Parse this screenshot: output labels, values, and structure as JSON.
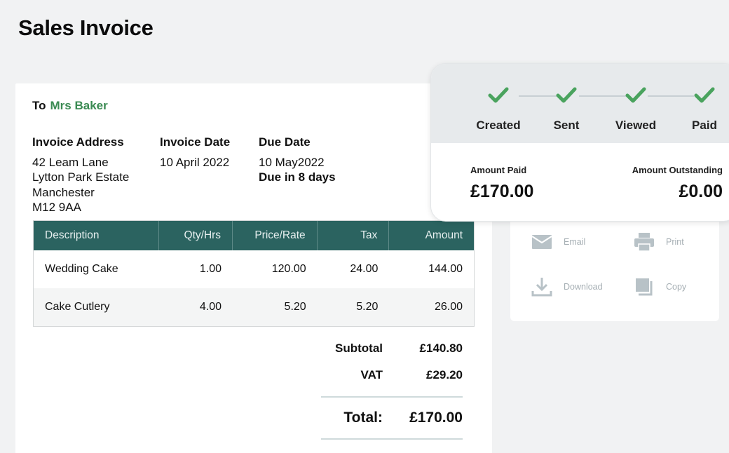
{
  "page": {
    "title": "Sales Invoice"
  },
  "invoice": {
    "to_label": "To",
    "to_name": "Mrs Baker",
    "address": {
      "heading": "Invoice Address",
      "lines": [
        "42 Leam Lane",
        "Lytton Park Estate",
        "Manchester",
        "M12 9AA"
      ]
    },
    "invoice_date": {
      "heading": "Invoice Date",
      "value": "10 April 2022"
    },
    "due_date": {
      "heading": "Due Date",
      "value": "10 May2022",
      "due_in": "Due in 8 days"
    },
    "table": {
      "headers": [
        "Description",
        "Qty/Hrs",
        "Price/Rate",
        "Tax",
        "Amount"
      ],
      "rows": [
        [
          "Wedding Cake",
          "1.00",
          "120.00",
          "24.00",
          "144.00"
        ],
        [
          "Cake Cutlery",
          "4.00",
          "5.20",
          "5.20",
          "26.00"
        ]
      ]
    },
    "totals": {
      "subtotal_label": "Subtotal",
      "subtotal_value": "£140.80",
      "vat_label": "VAT",
      "vat_value": "£29.20",
      "total_label": "Total:",
      "total_value": "£170.00"
    }
  },
  "actions": {
    "email": "Email",
    "print": "Print",
    "download": "Download",
    "copy": "Copy"
  },
  "status": {
    "steps": [
      "Created",
      "Sent",
      "Viewed",
      "Paid"
    ],
    "amount_paid_label": "Amount Paid",
    "amount_paid_value": "£170.00",
    "amount_outstanding_label": "Amount Outstanding",
    "amount_outstanding_value": "£0.00"
  },
  "colors": {
    "accent_green": "#3a8a52",
    "table_header": "#2b6360",
    "check_green": "#4aa35e"
  }
}
